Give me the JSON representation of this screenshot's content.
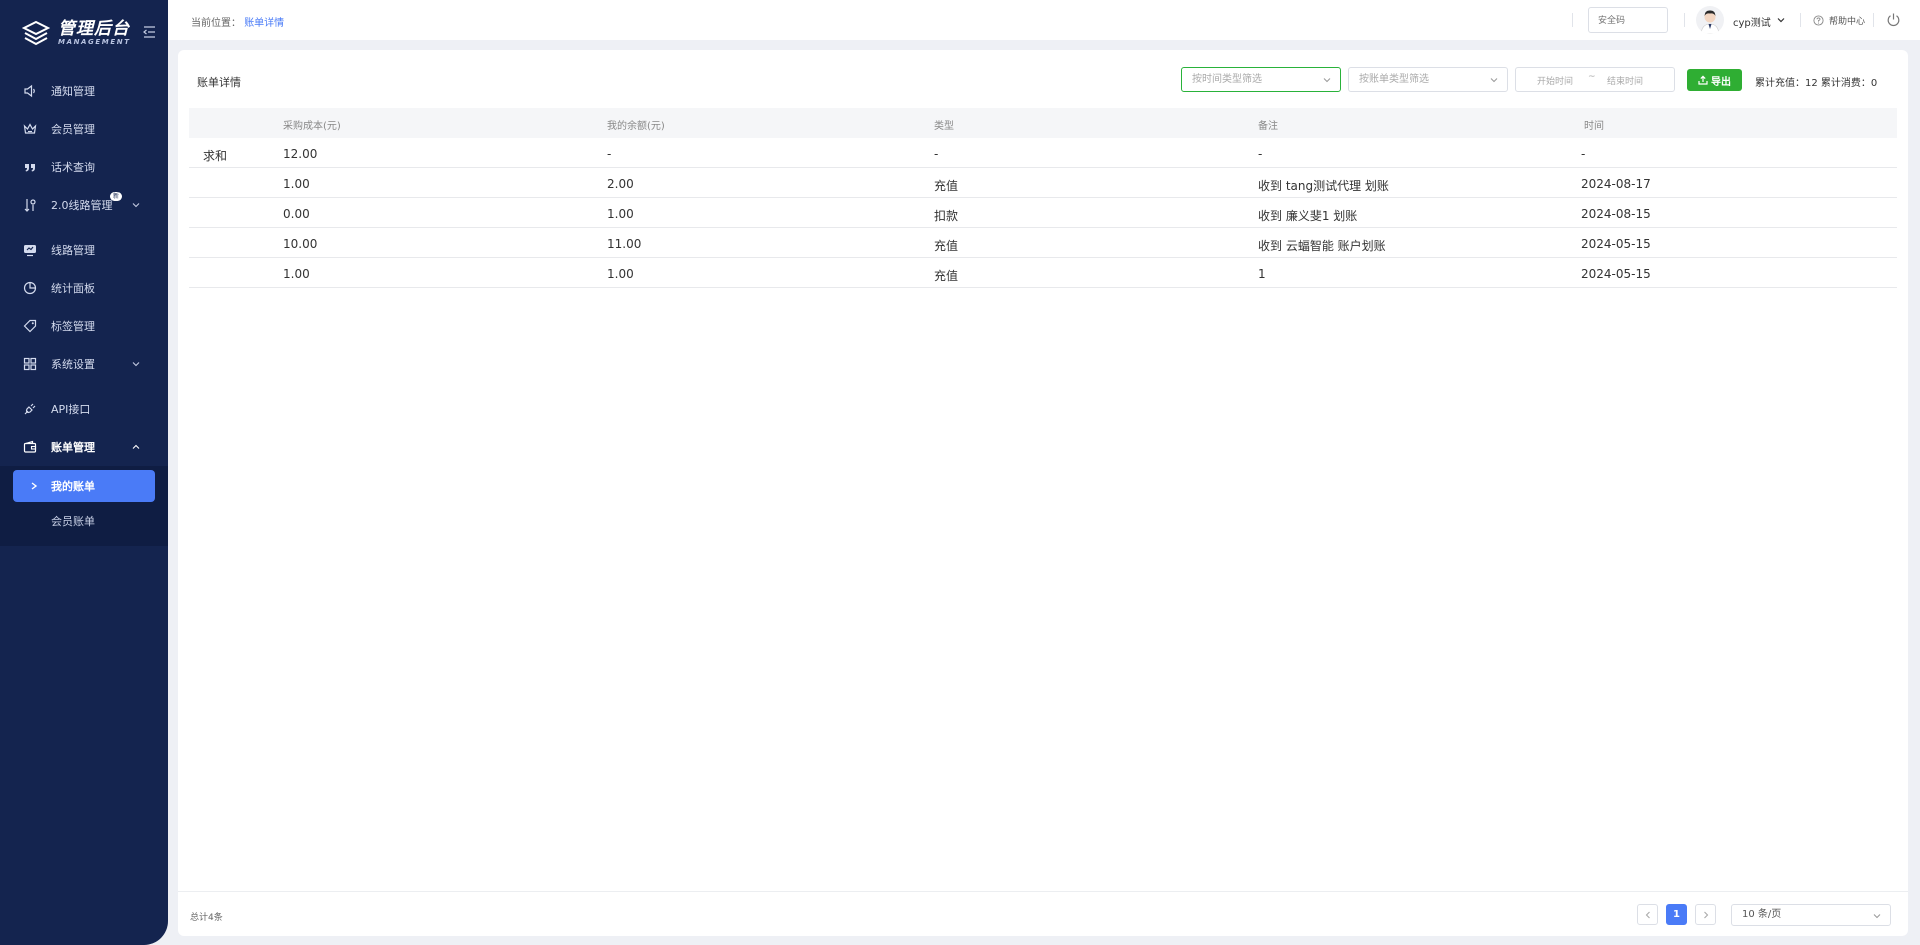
{
  "sidebar": {
    "logo_title": "管理后台",
    "logo_sub": "MANAGEMENT",
    "items": [
      {
        "label": "通知管理",
        "icon": "speaker-icon"
      },
      {
        "label": "会员管理",
        "icon": "crown-icon"
      },
      {
        "label": "话术查询",
        "icon": "quote-icon"
      },
      {
        "label": "2.0线路管理",
        "icon": "route-icon",
        "badge": "新"
      },
      {
        "label": "线路管理",
        "icon": "monitor-icon"
      },
      {
        "label": "统计面板",
        "icon": "pie-icon"
      },
      {
        "label": "标签管理",
        "icon": "tag-icon"
      },
      {
        "label": "系统设置",
        "icon": "grid-icon"
      },
      {
        "label": "API接口",
        "icon": "plug-icon"
      },
      {
        "label": "账单管理",
        "icon": "wallet-icon"
      }
    ],
    "submenu": [
      {
        "label": "我的账单",
        "active": true
      },
      {
        "label": "会员账单",
        "active": false
      }
    ],
    "colors": {
      "background": "#14244f",
      "active": "#4a7bf7"
    }
  },
  "header": {
    "breadcrumb_prefix": "当前位置：",
    "breadcrumb_current": "账单详情",
    "security_placeholder": "安全码",
    "username": "cyp测试",
    "help": "帮助中心"
  },
  "toolbar": {
    "title": "账单详情",
    "time_type_placeholder": "按时间类型筛选",
    "bill_type_placeholder": "按账单类型筛选",
    "start_time": "开始时间",
    "range_sep": "~",
    "end_time": "结束时间",
    "export_label": "导出",
    "totals": "累计充值：12  累计消费：0"
  },
  "table": {
    "columns": [
      "采购成本(元)",
      "我的余额(元)",
      "类型",
      "备注",
      "时间"
    ],
    "sum_label": "求和",
    "sum_row": [
      "12.00",
      "-",
      "-",
      "-",
      "-"
    ],
    "rows": [
      [
        "1.00",
        "2.00",
        "充值",
        "收到 tang测试代理 划账",
        "2024-08-17"
      ],
      [
        "0.00",
        "1.00",
        "扣款",
        "收到 廉义斐1 划账",
        "2024-08-15"
      ],
      [
        "10.00",
        "11.00",
        "充值",
        "收到 云蝠智能 账户划账",
        "2024-05-15"
      ],
      [
        "1.00",
        "1.00",
        "充值",
        "1",
        "2024-05-15"
      ]
    ]
  },
  "footer": {
    "total": "总计4条",
    "current_page": "1",
    "page_size": "10 条/页"
  }
}
